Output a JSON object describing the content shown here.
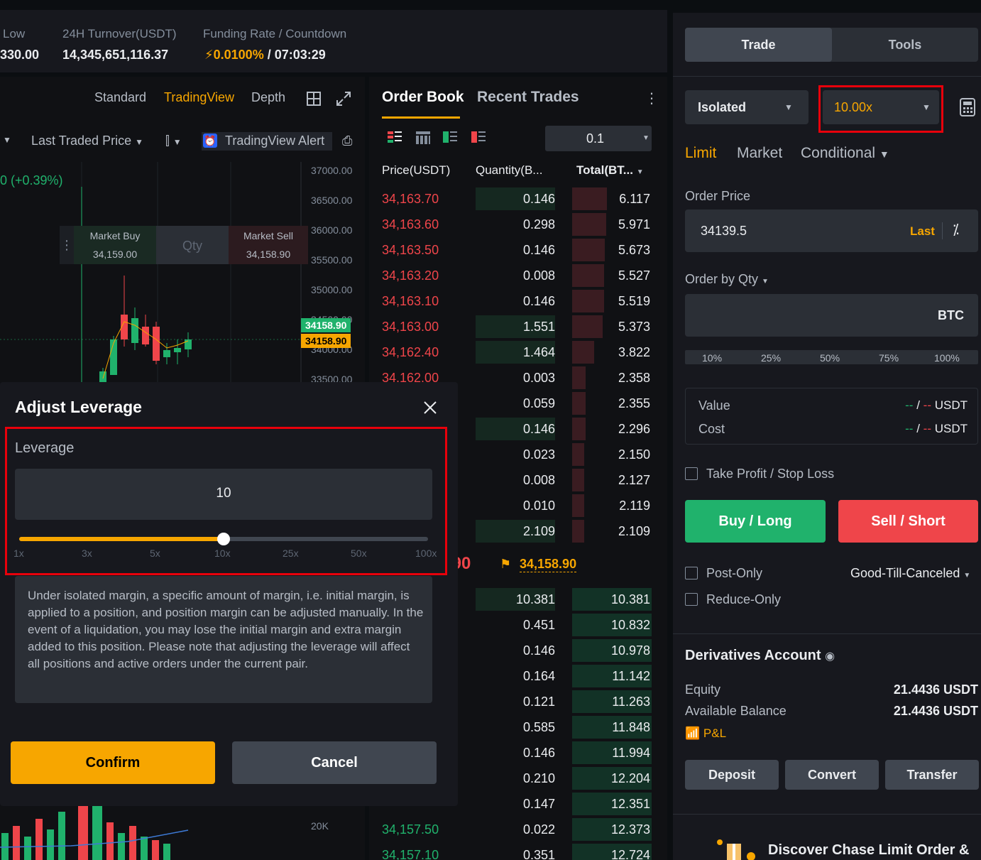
{
  "stats": {
    "low_label": "Low",
    "low_value": "330.00",
    "turnover_label": "24H Turnover(USDT)",
    "turnover_value": "14,345,651,116.37",
    "funding_label": "Funding Rate / Countdown",
    "funding_rate": "0.0100%",
    "countdown": "/ 07:03:29"
  },
  "chart": {
    "tabs": [
      "Standard",
      "TradingView",
      "Depth"
    ],
    "active_tab": "TradingView",
    "price_source": "Last Traded Price",
    "alert_label": "TradingView Alert",
    "change_text": "0 (+0.39%)",
    "market_buy_label": "Market Buy",
    "market_buy_price": "34,159.00",
    "qty_label": "Qty",
    "market_sell_label": "Market Sell",
    "market_sell_price": "34,158.90",
    "yaxis": [
      "37000.00",
      "36500.00",
      "36000.00",
      "35500.00",
      "35000.00",
      "34500.00",
      "34000.00",
      "33500.00"
    ],
    "tag_last": "34158.90",
    "tag_mark": "34158.90",
    "volume_label": "20K"
  },
  "orderbook": {
    "tab_order_book": "Order Book",
    "tab_recent_trades": "Recent Trades",
    "precision": "0.1",
    "col_price": "Price(USDT)",
    "col_qty": "Quantity(B...",
    "col_total": "Total(BT...",
    "asks": [
      {
        "price": "34,163.70",
        "qty": "0.146",
        "total": "6.117"
      },
      {
        "price": "34,163.60",
        "qty": "0.298",
        "total": "5.971"
      },
      {
        "price": "34,163.50",
        "qty": "0.146",
        "total": "5.673"
      },
      {
        "price": "34,163.20",
        "qty": "0.008",
        "total": "5.527"
      },
      {
        "price": "34,163.10",
        "qty": "0.146",
        "total": "5.519"
      },
      {
        "price": "34,163.00",
        "qty": "1.551",
        "total": "5.373"
      },
      {
        "price": "34,162.40",
        "qty": "1.464",
        "total": "3.822"
      },
      {
        "price": "34,162.00",
        "qty": "0.003",
        "total": "2.358"
      },
      {
        "price": "",
        "qty": "0.059",
        "total": "2.355"
      },
      {
        "price": "",
        "qty": "0.146",
        "total": "2.296"
      },
      {
        "price": "",
        "qty": "0.023",
        "total": "2.150"
      },
      {
        "price": "",
        "qty": "0.008",
        "total": "2.127"
      },
      {
        "price": "",
        "qty": "0.010",
        "total": "2.119"
      },
      {
        "price": "",
        "qty": "2.109",
        "total": "2.109"
      }
    ],
    "last_price_partial": ".90",
    "mark_price": "34,158.90",
    "bids": [
      {
        "price": "",
        "qty": "10.381",
        "total": "10.381"
      },
      {
        "price": "",
        "qty": "0.451",
        "total": "10.832"
      },
      {
        "price": "",
        "qty": "0.146",
        "total": "10.978"
      },
      {
        "price": "",
        "qty": "0.164",
        "total": "11.142"
      },
      {
        "price": "",
        "qty": "0.121",
        "total": "11.263"
      },
      {
        "price": "",
        "qty": "0.585",
        "total": "11.848"
      },
      {
        "price": "",
        "qty": "0.146",
        "total": "11.994"
      },
      {
        "price": "",
        "qty": "0.210",
        "total": "12.204"
      },
      {
        "price": "",
        "qty": "0.147",
        "total": "12.351"
      },
      {
        "price": "34,157.50",
        "qty": "0.022",
        "total": "12.373"
      },
      {
        "price": "34,157.10",
        "qty": "0.351",
        "total": "12.724"
      }
    ]
  },
  "trade_panel": {
    "tab_trade": "Trade",
    "tab_tools": "Tools",
    "margin_mode": "Isolated",
    "leverage": "10.00x",
    "order_types": [
      "Limit",
      "Market",
      "Conditional"
    ],
    "order_price_label": "Order Price",
    "order_price_value": "34139.5",
    "last_label": "Last",
    "order_by_label": "Order by Qty",
    "qty_unit": "BTC",
    "percents": [
      "10%",
      "25%",
      "50%",
      "75%",
      "100%"
    ],
    "value_label": "Value",
    "cost_label": "Cost",
    "value_dash": "--",
    "slash": "/",
    "usdt": "USDT",
    "tpsl_label": "Take Profit / Stop Loss",
    "buy_label": "Buy / Long",
    "sell_label": "Sell / Short",
    "post_only_label": "Post-Only",
    "tif_label": "Good-Till-Canceled",
    "reduce_only_label": "Reduce-Only",
    "account_title": "Derivatives Account",
    "equity_label": "Equity",
    "equity_value": "21.4436 USDT",
    "available_label": "Available Balance",
    "available_value": "21.4436 USDT",
    "pnl_label": "P&L",
    "deposit_label": "Deposit",
    "convert_label": "Convert",
    "transfer_label": "Transfer",
    "promo_text": "Discover Chase Limit Order &"
  },
  "modal": {
    "title": "Adjust Leverage",
    "leverage_label": "Leverage",
    "leverage_value": "10",
    "slider_value_fraction": 0.5,
    "ticks": [
      "1x",
      "3x",
      "5x",
      "10x",
      "25x",
      "50x",
      "100x"
    ],
    "description": "Under isolated margin, a specific amount of margin, i.e. initial margin, is applied to a position, and position margin can be adjusted manually. In the event of a liquidation, you may lose the initial margin and extra margin added to this position. Please note that adjusting the leverage will affect all positions and active orders under the current pair.",
    "confirm_label": "Confirm",
    "cancel_label": "Cancel"
  },
  "colors": {
    "accent": "#f7a600",
    "buy": "#20b26c",
    "sell": "#ef454a",
    "highlight": "#e8000b"
  }
}
